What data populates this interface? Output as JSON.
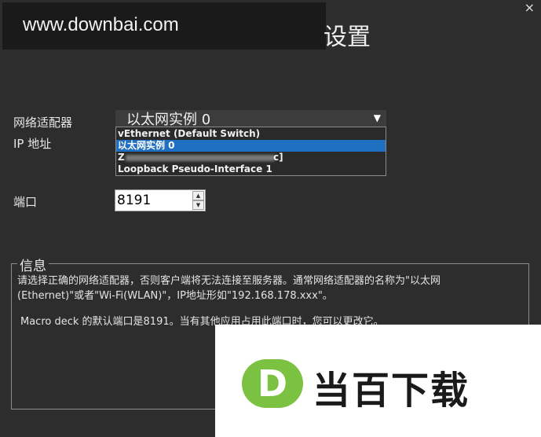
{
  "watermark": {
    "text": "www.downbai.com"
  },
  "window": {
    "title_fragment": "设置",
    "close_glyph": "×"
  },
  "adapter": {
    "label": "网络适配器",
    "selected": "以太网实例 0",
    "arrow": "▼",
    "options": [
      {
        "label": "vEthernet (Default Switch)",
        "selected": false
      },
      {
        "label": "以太网实例 0",
        "selected": true
      },
      {
        "label_start": "Z",
        "label_end": "c]",
        "selected": false
      },
      {
        "label": "Loopback Pseudo-Interface 1",
        "selected": false
      }
    ]
  },
  "ip": {
    "label": "IP 地址"
  },
  "port": {
    "label": "端口",
    "value": "8191",
    "up": "▲",
    "down": "▼"
  },
  "info": {
    "title": "信息",
    "line1": "请选择正确的网络适配器，否则客户端将无法连接至服务器。通常网络适配器的名称为\"以太网",
    "line2": "(Ethernet)\"或者\"Wi-Fi(WLAN)\"，IP地址形如\"192.168.178.xxx\"。",
    "line3": "Macro deck 的默认端口是8191。当有其他应用占用此端口时，您可以更改它。"
  },
  "promo": {
    "logo_letter": "D",
    "brand_text": "当百下载"
  },
  "colors": {
    "background": "#2d2d2d",
    "selection": "#1f6fc2",
    "logo_green": "#7cc242"
  }
}
